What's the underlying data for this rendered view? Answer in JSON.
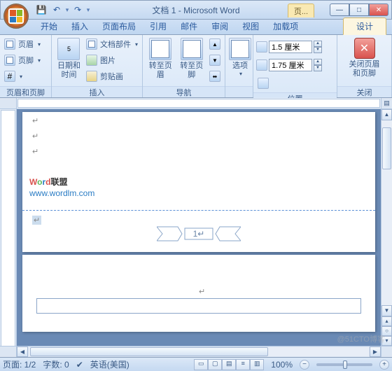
{
  "title": "文档 1 - Microsoft Word",
  "context_tab": "页...",
  "tabs": [
    "开始",
    "插入",
    "页面布局",
    "引用",
    "邮件",
    "审阅",
    "视图",
    "加载项"
  ],
  "design_tab": "设计",
  "ribbon": {
    "g1": {
      "label": "页眉和页脚",
      "header": "页眉",
      "footer": "页脚",
      "pagenum": "#"
    },
    "g2": {
      "label": "插入",
      "datetime": "日期和\n时间",
      "parts": "文档部件",
      "picture": "图片",
      "clipart": "剪贴画"
    },
    "g3": {
      "label": "导航",
      "goto_header": "转至页眉",
      "goto_footer": "转至页脚"
    },
    "g4": {
      "label": "",
      "options": "选项"
    },
    "g5": {
      "label": "位置",
      "top_val": "1.5 厘米",
      "bot_val": "1.75 厘米"
    },
    "g6": {
      "label": "关闭",
      "close": "关闭页眉\n和页脚"
    }
  },
  "watermark": {
    "text": "Word联盟",
    "url": "www.wordlm.com"
  },
  "footer_page_number": "1",
  "status": {
    "page": "页面: 1/2",
    "words": "字数: 0",
    "lang": "英语(美国)",
    "zoom": "100%"
  },
  "sitewm": "@51CTO博客"
}
